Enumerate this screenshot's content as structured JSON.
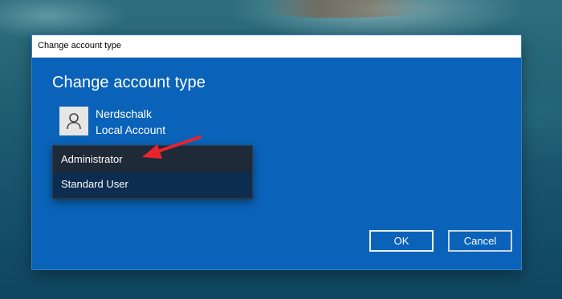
{
  "window": {
    "title": "Change account type"
  },
  "dialog": {
    "heading": "Change account type",
    "user": {
      "name": "Nerdschalk",
      "account_type": "Local Account",
      "avatar_icon": "user-icon"
    },
    "dropdown": {
      "options": [
        "Administrator",
        "Standard User"
      ],
      "highlighted": "Standard User"
    },
    "buttons": {
      "ok_label": "OK",
      "cancel_label": "Cancel"
    }
  },
  "colors": {
    "dialog_background": "#0a63b8",
    "dropdown_background": "#1e2a38",
    "highlight": "#0c2d4f",
    "annotation_arrow": "#e8242b"
  }
}
